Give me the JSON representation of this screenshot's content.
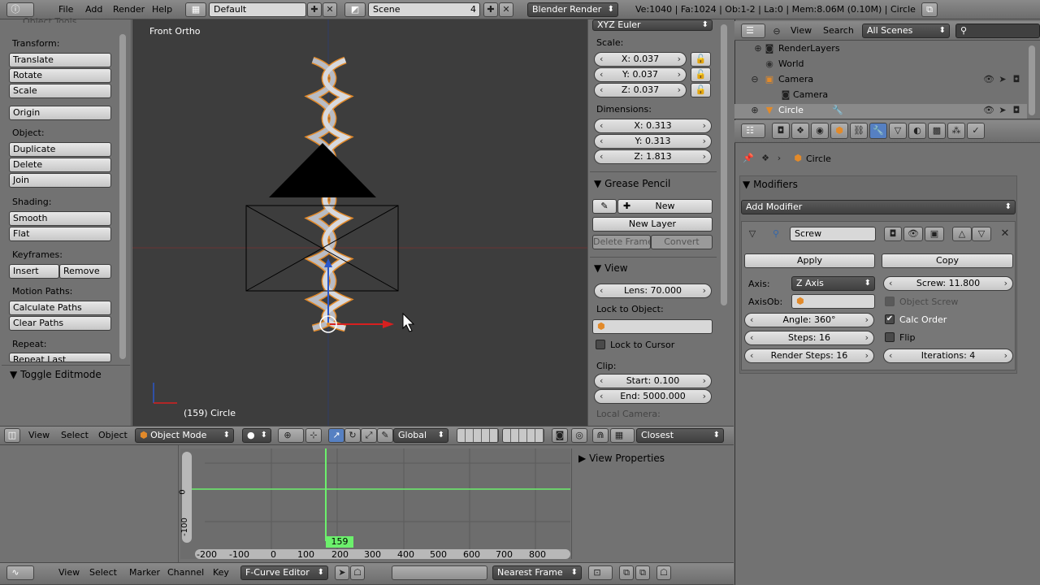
{
  "topbar": {
    "menus": [
      "File",
      "Add",
      "Render",
      "Help"
    ],
    "screen": "Default",
    "scene": "Scene",
    "scene_count": "4",
    "engine": "Blender Render",
    "stats": "Ve:1040 | Fa:1024 | Ob:1-2 | La:0 | Mem:8.06M (0.10M) | Circle"
  },
  "toolshelf": {
    "title": "Object Tools",
    "transform_label": "Transform:",
    "translate": "Translate",
    "rotate": "Rotate",
    "scale": "Scale",
    "origin": "Origin",
    "object_label": "Object:",
    "duplicate": "Duplicate",
    "delete": "Delete",
    "join": "Join",
    "shading_label": "Shading:",
    "smooth": "Smooth",
    "flat": "Flat",
    "keyframes_label": "Keyframes:",
    "insert": "Insert",
    "remove": "Remove",
    "motion_label": "Motion Paths:",
    "calc_paths": "Calculate Paths",
    "clear_paths": "Clear Paths",
    "repeat_label": "Repeat:",
    "repeat_last": "Repeat Last",
    "toggle_editmode": "Toggle Editmode"
  },
  "viewport": {
    "view_name": "Front Ortho",
    "object_info": "(159) Circle"
  },
  "nprops": {
    "rotation_mode": "XYZ Euler",
    "scale_label": "Scale:",
    "scale_x": "X: 0.037",
    "scale_y": "Y: 0.037",
    "scale_z": "Z: 0.037",
    "dimensions_label": "Dimensions:",
    "dim_x": "X: 0.313",
    "dim_y": "Y: 0.313",
    "dim_z": "Z: 1.813",
    "grease_pencil": "Grease Pencil",
    "new": "New",
    "new_layer": "New Layer",
    "delete_frame": "Delete Frame",
    "convert": "Convert",
    "view": "View",
    "lens": "Lens: 70.000",
    "lock_object": "Lock to Object:",
    "lock_cursor": "Lock to Cursor",
    "clip_label": "Clip:",
    "clip_start": "Start: 0.100",
    "clip_end": "End: 5000.000",
    "local_camera": "Local Camera:"
  },
  "view3d_header": {
    "menus": [
      "View",
      "Select",
      "Object"
    ],
    "mode": "Object Mode",
    "orientation": "Global",
    "snap_target": "Closest"
  },
  "graph": {
    "view_properties": "View Properties",
    "x_ticks": [
      "-200",
      "-100",
      "0",
      "100",
      "200",
      "300",
      "400",
      "500",
      "600",
      "700",
      "800"
    ],
    "y_ticks": [
      "0",
      "-100"
    ],
    "current_frame": "159"
  },
  "graph_header": {
    "menus": [
      "View",
      "Select",
      "Marker",
      "Channel",
      "Key"
    ],
    "editor": "F-Curve Editor",
    "auto_snap": "Nearest Frame"
  },
  "outliner": {
    "view": "View",
    "search": "Search",
    "filter": "All Scenes",
    "items": [
      "RenderLayers",
      "World",
      "Camera",
      "Camera",
      "Circle"
    ]
  },
  "properties": {
    "breadcrumb": "Circle",
    "modifiers_title": "Modifiers",
    "add_modifier": "Add Modifier",
    "modifier_name": "Screw",
    "apply": "Apply",
    "copy": "Copy",
    "axis_label": "Axis:",
    "axis_value": "Z Axis",
    "screw": "Screw: 11.800",
    "axisob_label": "AxisOb:",
    "object_screw": "Object Screw",
    "angle": "Angle: 360°",
    "calc_order": "Calc Order",
    "steps": "Steps: 16",
    "flip": "Flip",
    "render_steps": "Render Steps: 16",
    "iterations": "Iterations: 4"
  }
}
